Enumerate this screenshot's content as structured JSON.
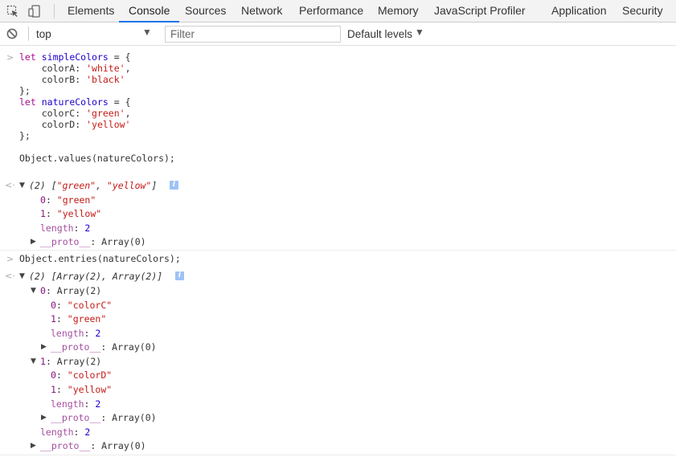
{
  "tabs": {
    "elements": "Elements",
    "console": "Console",
    "sources": "Sources",
    "network": "Network",
    "performance": "Performance",
    "memory": "Memory",
    "js_profiler": "JavaScript Profiler",
    "application": "Application",
    "security": "Security"
  },
  "filterbar": {
    "context": "top",
    "filter_placeholder": "Filter",
    "levels": "Default levels"
  },
  "colors": {
    "keyword": "#aa0d91",
    "string": "#c41a16",
    "number": "#1c00cf",
    "property": "#881280",
    "accent": "#1a73e8"
  },
  "console": {
    "input1": {
      "l1_kw": "let",
      "l1_var": "simpleColors",
      "l1_rest": " = {",
      "l2_key": "    colorA: ",
      "l2_val": "'white'",
      "l2_end": ",",
      "l3_key": "    colorB: ",
      "l3_val": "'black'",
      "l4": "};",
      "l5_kw": "let",
      "l5_var": "natureColors",
      "l5_rest": " = {",
      "l6_key": "    colorC: ",
      "l6_val": "'green'",
      "l6_end": ",",
      "l7_key": "    colorD: ",
      "l7_val": "'yellow'",
      "l8": "};",
      "l9": "Object.values(natureColors);"
    },
    "output1": {
      "summary_pre": "(2) [",
      "summary_s1": "\"green\"",
      "summary_mid": ", ",
      "summary_s2": "\"yellow\"",
      "summary_post": "]",
      "i0_key": "0",
      "i0_val": "\"green\"",
      "i1_key": "1",
      "i1_val": "\"yellow\"",
      "len_key": "length",
      "len_val": "2",
      "proto_key": "__proto__",
      "proto_val": ": Array(0)"
    },
    "input2": "Object.entries(natureColors);",
    "output2": {
      "summary": "(2) [Array(2), Array(2)]",
      "a0_key": "0",
      "a0_val": ": Array(2)",
      "a0_i0_key": "0",
      "a0_i0_val": "\"colorC\"",
      "a0_i1_key": "1",
      "a0_i1_val": "\"green\"",
      "a0_len_key": "length",
      "a0_len_val": "2",
      "a0_proto_key": "__proto__",
      "a0_proto_val": ": Array(0)",
      "a1_key": "1",
      "a1_val": ": Array(2)",
      "a1_i0_key": "0",
      "a1_i0_val": "\"colorD\"",
      "a1_i1_key": "1",
      "a1_i1_val": "\"yellow\"",
      "a1_len_key": "length",
      "a1_len_val": "2",
      "a1_proto_key": "__proto__",
      "a1_proto_val": ": Array(0)",
      "len_key": "length",
      "len_val": "2",
      "proto_key": "__proto__",
      "proto_val": ": Array(0)"
    },
    "prompt_glyph": ">",
    "result_glyph": "<·",
    "expanded_glyph": "▼",
    "collapsed_glyph": "▶",
    "info_glyph": "i",
    "sep": ": "
  }
}
